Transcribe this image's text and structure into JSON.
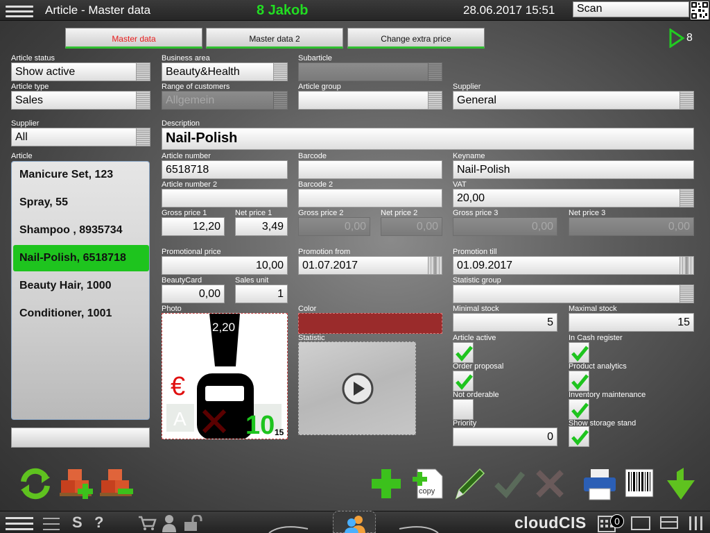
{
  "header": {
    "title": "Article - Master data",
    "user": "8 Jakob",
    "datetime": "28.06.2017 15:51",
    "scan_value": "Scan"
  },
  "tabs": [
    {
      "label": "Master data",
      "active": true
    },
    {
      "label": "Master data 2",
      "active": false
    },
    {
      "label": "Change extra price",
      "active": false
    }
  ],
  "tab_counter": "8",
  "filters": {
    "article_status": {
      "label": "Article status",
      "value": "Show active"
    },
    "article_type": {
      "label": "Article type",
      "value": "Sales"
    },
    "supplier": {
      "label": "Supplier",
      "value": "All"
    },
    "article_label": "Article"
  },
  "articles": [
    {
      "label": "Manicure Set, 123",
      "selected": false
    },
    {
      "label": "Spray, 55",
      "selected": false
    },
    {
      "label": "Shampoo , 8935734",
      "selected": false
    },
    {
      "label": "Nail-Polish, 6518718",
      "selected": true
    },
    {
      "label": "Beauty Hair, 1000",
      "selected": false
    },
    {
      "label": "Conditioner, 1001",
      "selected": false
    }
  ],
  "form": {
    "business_area": {
      "label": "Business area",
      "value": "Beauty&Health"
    },
    "subarticle": {
      "label": "Subarticle",
      "value": ""
    },
    "range_of_customers": {
      "label": "Range of customers",
      "value": "Allgemein"
    },
    "article_group": {
      "label": "Article group",
      "value": ""
    },
    "supplier": {
      "label": "Supplier",
      "value": "General"
    },
    "description": {
      "label": "Description",
      "value": "Nail-Polish"
    },
    "article_number": {
      "label": "Article number",
      "value": "6518718"
    },
    "barcode": {
      "label": "Barcode",
      "value": ""
    },
    "keyname": {
      "label": "Keyname",
      "value": "Nail-Polish"
    },
    "article_number_2": {
      "label": "Article number 2",
      "value": ""
    },
    "barcode_2": {
      "label": "Barcode 2",
      "value": ""
    },
    "vat": {
      "label": "VAT",
      "value": "20,00"
    },
    "gross_price_1": {
      "label": "Gross price 1",
      "value": "12,20"
    },
    "net_price_1": {
      "label": "Net price 1",
      "value": "3,49"
    },
    "gross_price_2": {
      "label": "Gross price 2",
      "value": "0,00"
    },
    "net_price_2": {
      "label": "Net price 2",
      "value": "0,00"
    },
    "gross_price_3": {
      "label": "Gross price 3",
      "value": "0,00"
    },
    "net_price_3": {
      "label": "Net price 3",
      "value": "0,00"
    },
    "promotional_price": {
      "label": "Promotional price",
      "value": "10,00"
    },
    "promotion_from": {
      "label": "Promotion from",
      "value": "01.07.2017"
    },
    "promotion_till": {
      "label": "Promotion till",
      "value": "01.09.2017"
    },
    "beautycard": {
      "label": "BeautyCard",
      "value": "0,00"
    },
    "sales_unit": {
      "label": "Sales unit",
      "value": "1"
    },
    "statistic_group": {
      "label": "Statistic group",
      "value": ""
    },
    "photo_label": "Photo",
    "color_label": "Color",
    "statistic_label": "Statistic",
    "minimal_stock": {
      "label": "Minimal stock",
      "value": "5"
    },
    "maximal_stock": {
      "label": "Maximal stock",
      "value": "15"
    },
    "priority": {
      "label": "Priority",
      "value": "0"
    }
  },
  "photo": {
    "price_text": "2,20",
    "currency": "€",
    "big_number": "10",
    "small_number": "15",
    "letter": "A"
  },
  "checks": {
    "article_active": {
      "label": "Article active",
      "checked": true
    },
    "in_cash_register": {
      "label": "In Cash register",
      "checked": true
    },
    "order_proposal": {
      "label": "Order proposal",
      "checked": true
    },
    "product_analytics": {
      "label": "Product analytics",
      "checked": true
    },
    "not_orderable": {
      "label": "Not orderable",
      "checked": false
    },
    "inventory_maintenance": {
      "label": "Inventory maintenance",
      "checked": true
    },
    "show_storage_stand": {
      "label": "Show storage stand",
      "checked": true
    }
  },
  "toolbar": {
    "copy_label": "copy"
  },
  "bottom": {
    "brand": "cloudCIS",
    "cart_count": "0",
    "s_label": "S",
    "help_label": "?"
  },
  "colors": {
    "accent_green": "#1ec41e",
    "active_tab_red": "#e81c1c",
    "color_swatch": "#9a2b2b"
  }
}
